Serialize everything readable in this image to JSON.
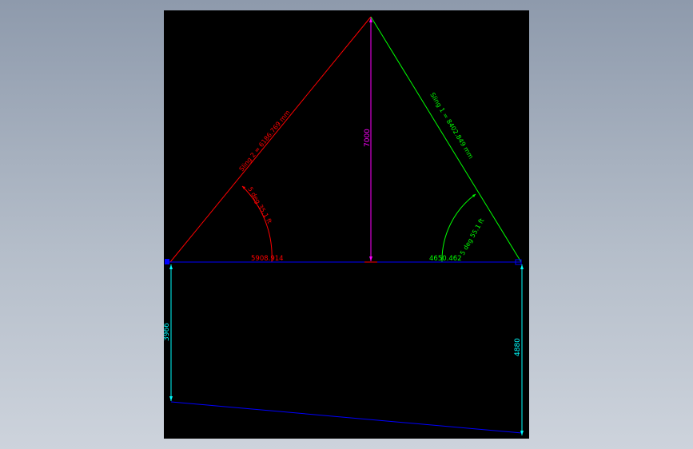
{
  "colors": {
    "background": "#000000",
    "red": "#ff0000",
    "green": "#00ff00",
    "blue": "#0000ff",
    "magenta": "#ff00ff",
    "cyan": "#00ffff"
  },
  "labels": {
    "sling_left": "Sling 2 = 6186.769 mm",
    "sling_right": "Sling 1 = 8402.849 mm",
    "angle_left": "5 deg 35.1 ft",
    "angle_right": "5 deg 55.1 ft",
    "dist_left": "5908.914",
    "dist_right": "4650.462",
    "height": "7000",
    "dim_left": "3966",
    "dim_right": "4880"
  }
}
